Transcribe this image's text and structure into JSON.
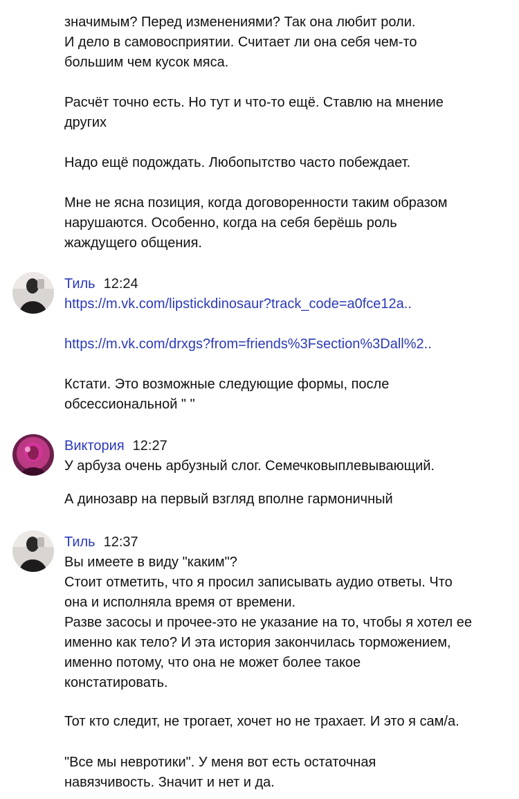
{
  "colors": {
    "author": "#2a39b8",
    "link": "#2a39b8",
    "text": "#111111",
    "background": "#ffffff"
  },
  "continuation": {
    "lines": [
      "значимым? Перед изменениями? Так она любит роли.",
      "И дело в самовосприятии. Считает ли она себя чем-то",
      "большим чем кусок мяса.",
      "Расчёт точно есть. Но тут и что-то ещё. Ставлю на мнение",
      "других",
      "Надо ещё подождать. Любопытство часто побеждает.",
      "Мне не ясна позиция, когда договоренности таким образом",
      "нарушаются. Особенно, когда на себя берёшь роль",
      "жаждущего общения."
    ]
  },
  "messages": [
    {
      "author": "Тиль",
      "time": "12:24",
      "avatar_icon": "person-dark-avatar",
      "lines": [
        "https://m.vk.com/lipstickdinosaur?track_code=a0fce12a..",
        "https://m.vk.com/drxgs?from=friends%3Fsection%3Dall%2..",
        "Кстати. Это возможные следующие формы, после",
        "обсессиональной \" \""
      ]
    },
    {
      "author": "Виктория",
      "time": "12:27",
      "avatar_icon": "person-neon-avatar",
      "lines": [
        "У арбуза очень арбузный слог. Семечковыплевывающий.",
        "А динозавр на первый взгляд вполне гармоничный"
      ]
    },
    {
      "author": "Тиль",
      "time": "12:37",
      "avatar_icon": "person-dark-avatar",
      "lines": [
        "Вы имеете в виду \"каким\"?",
        "Стоит отметить, что я просил записывать аудио ответы. Что",
        "она и исполняла время от времени.",
        "Разве засосы и прочее-это не указание на то, чтобы я хотел ее",
        "именно как тело? И эта история закончилась торможением,",
        "именно потому, что она не может более такое",
        "констатировать.",
        "Тот кто следит, не трогает, хочет но не трахает. И это я сам/а.",
        "\"Все мы невротики\". У меня вот есть остаточная",
        "навязчивость. Значит и нет и да."
      ]
    }
  ]
}
